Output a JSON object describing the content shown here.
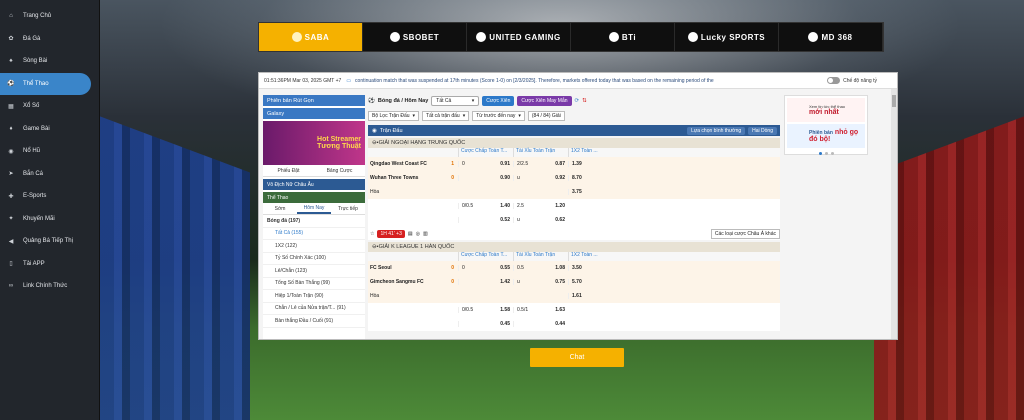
{
  "nav": [
    {
      "label": "Trang Chủ",
      "icon": "home-icon",
      "glyph": "⌂"
    },
    {
      "label": "Đá Gà",
      "icon": "rooster-icon",
      "glyph": "✿"
    },
    {
      "label": "Sòng Bài",
      "icon": "cards-icon",
      "glyph": "♠"
    },
    {
      "label": "Thể Thao",
      "icon": "soccer-ball-icon",
      "glyph": "⚽",
      "active": true
    },
    {
      "label": "Xổ Số",
      "icon": "lottery-icon",
      "glyph": "▦"
    },
    {
      "label": "Game Bài",
      "icon": "card-game-icon",
      "glyph": "♦"
    },
    {
      "label": "Nổ Hũ",
      "icon": "jackpot-icon",
      "glyph": "◉"
    },
    {
      "label": "Bắn Cá",
      "icon": "fish-icon",
      "glyph": "➤"
    },
    {
      "label": "E-Sports",
      "icon": "gamepad-icon",
      "glyph": "✚"
    },
    {
      "label": "Khuyến Mãi",
      "icon": "gift-icon",
      "glyph": "✦"
    },
    {
      "label": "Quảng Bá Tiếp Thị",
      "icon": "megaphone-icon",
      "glyph": "◀"
    },
    {
      "label": "Tải APP",
      "icon": "phone-icon",
      "glyph": "▯"
    },
    {
      "label": "Link Chính Thức",
      "icon": "link-icon",
      "glyph": "∞"
    }
  ],
  "providers": [
    "SABA",
    "SBOBET",
    "UNITED GAMING",
    "BTi",
    "Lucky SPORTS",
    "MD 368"
  ],
  "topline": {
    "time": "01:51:36PM Mar 03, 2025 GMT +7",
    "note": "continuation match that was suspended at 17th minutes (Score 1-0) on [2/3/2025]. Therefore, markets offered today that was based on the remaining period of the",
    "odds_mode": "Chế độ nâng tỷ"
  },
  "left": {
    "btn1": "Phiên bản Rút Gọn",
    "btn2": "Galaxy",
    "banner1": "Hot Streamer",
    "banner2": "Tương Thuật",
    "tab1": "Phiếu Đặt",
    "tab2": "Bảng Cược",
    "sec1": "Vô Địch Nữ Châu Âu",
    "sec2": "Thể Thao",
    "subtabs": [
      "Sớm",
      "Hôm Nay",
      "Trực tiếp"
    ],
    "sport": "Bóng đá  (197)",
    "items": [
      "Tất Cả (155)",
      "1X2 (122)",
      "Tỷ Số Chính Xác (100)",
      "Lẻ/Chẵn (123)",
      "Tổng Số Bàn Thắng (99)",
      "Hiệp 1/Toàn Trận (90)",
      "Chẵn / Lẻ của Nửa trận/T... (91)",
      "Bàn thắng Đầu / Cuối (91)"
    ]
  },
  "center": {
    "title": "Bóng đá / Hôm Nay",
    "select": "Tất Cả",
    "btn_cuoc": "Cược Xiên",
    "btn_xien": "Cược Xiên May Mắn",
    "filters": [
      "Bộ Lọc Trận Đấu",
      "Tất cả trận đấu",
      "Từ trước đến nay",
      "(84 / 84) Giải"
    ],
    "tranhdau": "Trận Đấu",
    "sort": "Lựa chọn bình thường",
    "lines": "Hai Dòng",
    "cols": [
      "Cược Chấp Toàn T...",
      "Tài Xỉu Toàn Trận",
      "1X2 Toàn ..."
    ],
    "league1": "GIẢI NGOẠI HẠNG TRUNG QUỐC",
    "m1": {
      "home": "Qingdao West Coast FC",
      "hs": "1",
      "away": "Wuhan Three Towns",
      "as": "0",
      "draw": "Hòa",
      "r1": [
        "0",
        "0.91",
        "2/2.5",
        "0.87",
        "1.39"
      ],
      "r2": [
        "",
        "0.90",
        "u",
        "0.92",
        "8.70"
      ],
      "r3": [
        "",
        "",
        "",
        "",
        "3.75"
      ],
      "r4": [
        "0/0.5",
        "1.40",
        "2.5",
        "1.20",
        ""
      ],
      "r5": [
        "",
        "0.52",
        "u",
        "0.62",
        ""
      ]
    },
    "live": "1H  41' +3",
    "other": "Các loại cược Châu Á khác",
    "league2": "GIẢI K LEAGUE 1 HÀN QUỐC",
    "m2": {
      "home": "FC Seoul",
      "hs": "0",
      "away": "Gimcheon Sangmu FC",
      "as": "0",
      "draw": "Hòa",
      "r1": [
        "0",
        "0.55",
        "0.5",
        "1.08",
        "3.50"
      ],
      "r2": [
        "",
        "1.42",
        "u",
        "0.75",
        "5.70"
      ],
      "r3": [
        "",
        "",
        "",
        "",
        "1.61"
      ],
      "r4": [
        "0/0.5",
        "1.58",
        "0.5/1",
        "1.63",
        ""
      ],
      "r5": [
        "",
        "0.45",
        "",
        "0.44",
        ""
      ]
    }
  },
  "right": {
    "ad1a": "Xem tin tức thể thao",
    "ad1b": "mới nhất",
    "ad2a": "Phiên bản",
    "ad2b": "nhỏ gọ",
    "ad2c": "đó bộ!"
  },
  "chat": "Chat"
}
